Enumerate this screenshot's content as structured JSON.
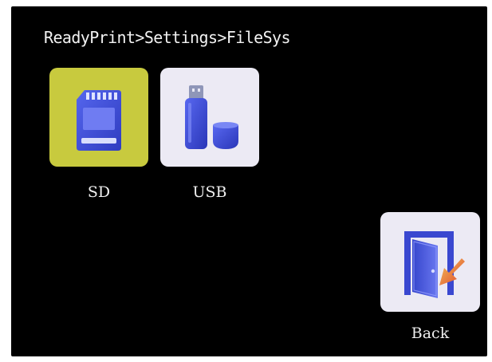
{
  "header": {
    "breadcrumb": "ReadyPrint>Settings>FileSys"
  },
  "file_systems": [
    {
      "label": "SD",
      "icon": "sd-card-icon",
      "selected": true
    },
    {
      "label": "USB",
      "icon": "usb-drive-icon",
      "selected": false
    }
  ],
  "back": {
    "label": "Back",
    "icon": "exit-door-icon"
  },
  "colors": {
    "screen_background": "#000000",
    "selected_tile": "#c8ca3e",
    "tile": "#eceaf4",
    "icon_blue": "#3f4fd8",
    "text": "#f0f0f0"
  }
}
